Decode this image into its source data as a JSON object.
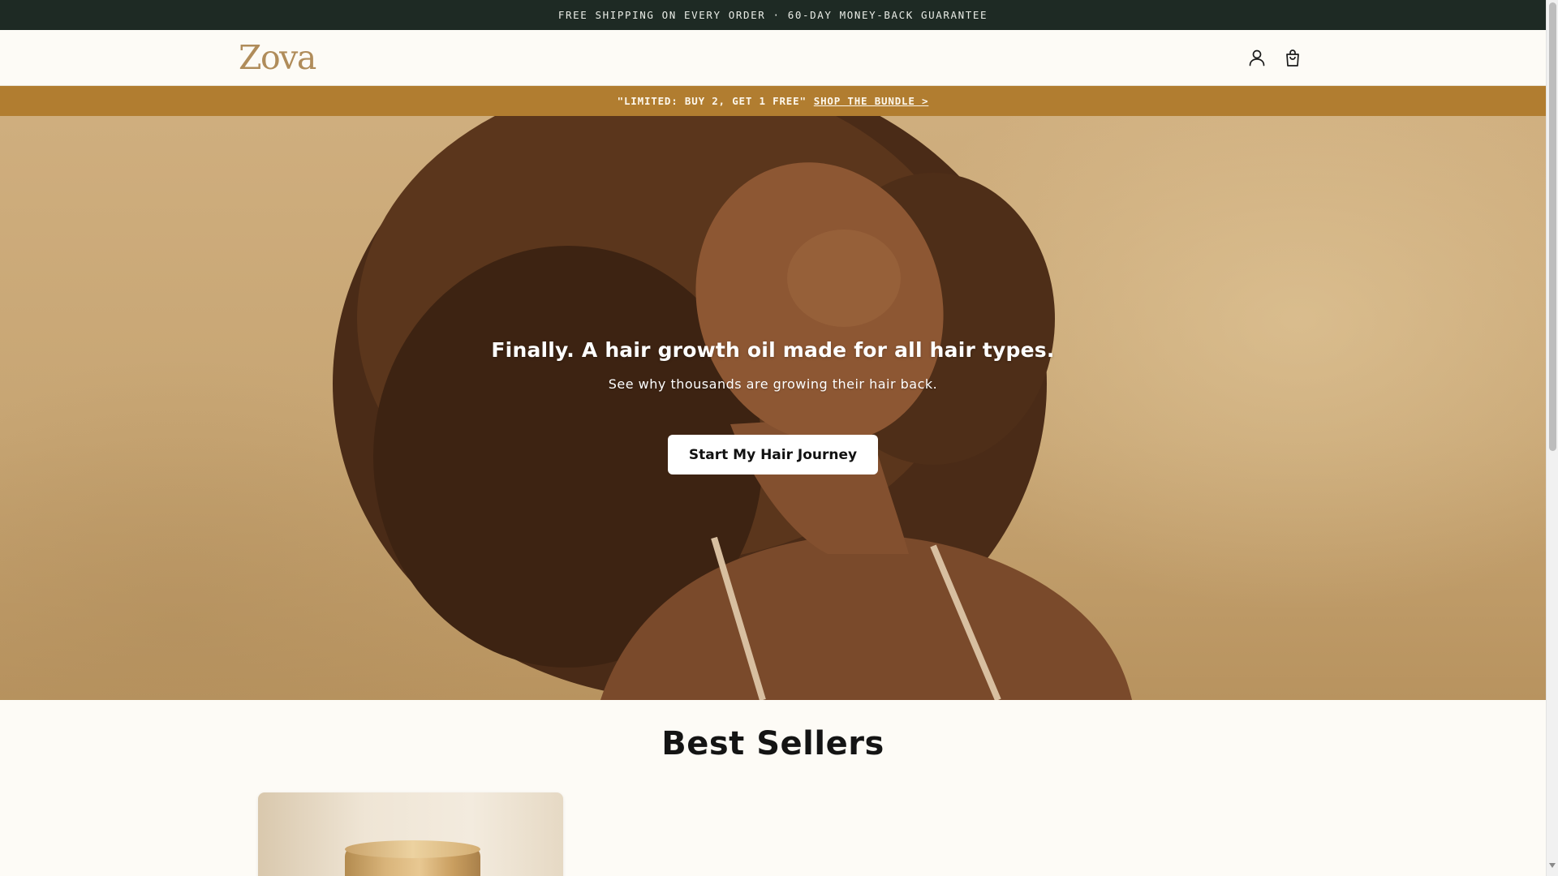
{
  "announcement": {
    "text": "FREE SHIPPING ON EVERY ORDER · 60-DAY MONEY-BACK GUARANTEE"
  },
  "header": {
    "logo": "Zova",
    "icons": [
      "account-icon",
      "cart-icon"
    ]
  },
  "promo": {
    "text": "\"LIMITED: BUY 2, GET 1 FREE\"",
    "link": "SHOP THE BUNDLE >"
  },
  "hero": {
    "headline": "Finally. A hair growth oil made for all hair types.",
    "subheadline": "See why thousands are growing their hair back.",
    "cta": "Start My Hair Journey"
  },
  "best_sellers": {
    "title": "Best Sellers"
  },
  "colors": {
    "announcement_bg": "#1e2a24",
    "promo_bg": "#b17d30",
    "logo": "#b08c5a",
    "page_bg": "#fdfbf6"
  }
}
